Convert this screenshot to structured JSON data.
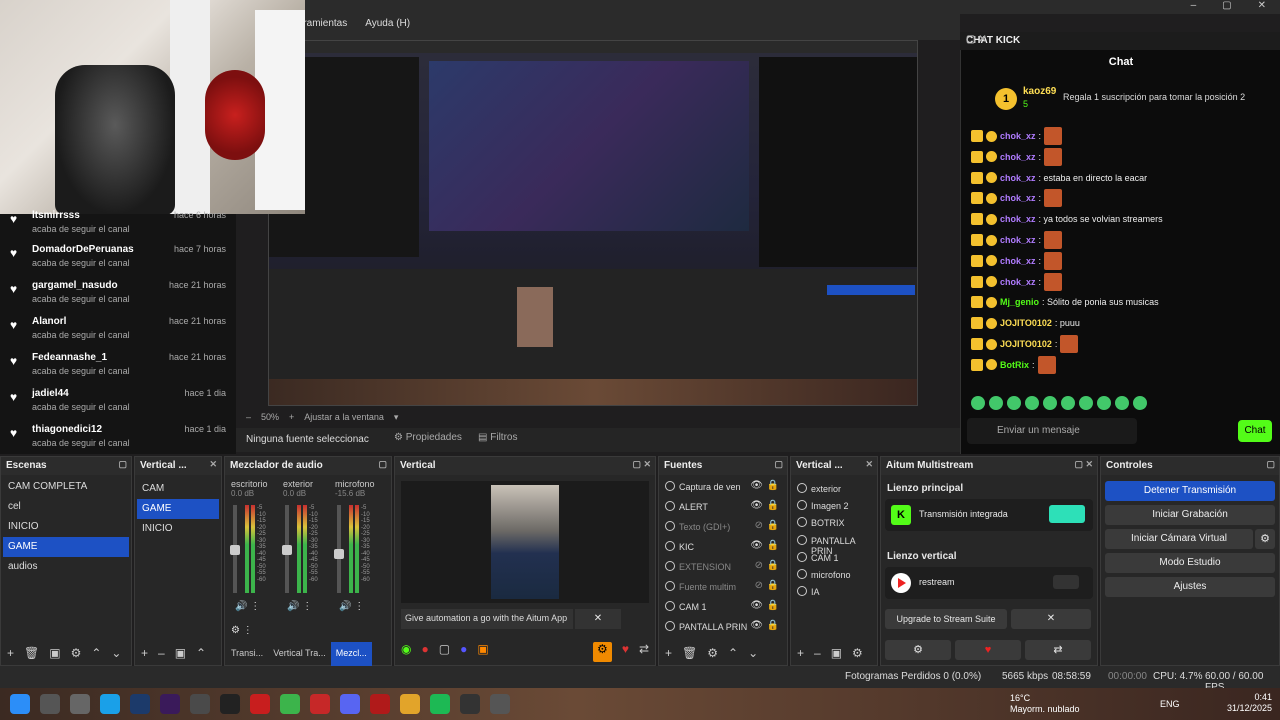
{
  "menu": [
    "rramientas",
    "Ayuda (H)"
  ],
  "window_controls": [
    "–",
    "▢",
    "✕"
  ],
  "feed": [
    {
      "user": "ltsmirrsss",
      "sub": "acaba de seguir el canal",
      "time": "hace 6 horas"
    },
    {
      "user": "DomadorDePeruanas",
      "sub": "acaba de seguir el canal",
      "time": "hace 7 horas"
    },
    {
      "user": "gargamel_nasudo",
      "sub": "acaba de seguir el canal",
      "time": "hace 21 horas"
    },
    {
      "user": "Alanorl",
      "sub": "acaba de seguir el canal",
      "time": "hace 21 horas"
    },
    {
      "user": "Fedeannashe_1",
      "sub": "acaba de seguir el canal",
      "time": "hace 21 horas"
    },
    {
      "user": "jadiel44",
      "sub": "acaba de seguir el canal",
      "time": "hace 1 dia"
    },
    {
      "user": "thiagonedici12",
      "sub": "acaba de seguir el canal",
      "time": "hace 1 dia"
    }
  ],
  "zoom": {
    "value": "50%",
    "fit": "Ajustar a la ventana"
  },
  "source_bar": {
    "label": "Ninguna fuente seleccionac",
    "props": "Propiedades",
    "filters": "Filtros"
  },
  "chat": {
    "dock_title": "CHAT KICK",
    "header": "Chat",
    "pinned": {
      "name": "kaoz69",
      "count": "5",
      "badge": "1",
      "message": "Regala 1 suscripción para tomar la posición 2"
    },
    "lines": [
      {
        "user": "chok_xz",
        "text": ":",
        "color": "#b07cff"
      },
      {
        "user": "chok_xz",
        "text": ":",
        "color": "#b07cff"
      },
      {
        "user": "chok_xz",
        "text": ": estaba en directo la eacar",
        "color": "#b07cff"
      },
      {
        "user": "chok_xz",
        "text": ":",
        "color": "#b07cff"
      },
      {
        "user": "chok_xz",
        "text": ": ya todos se volvian streamers",
        "color": "#b07cff"
      },
      {
        "user": "chok_xz",
        "text": ":",
        "color": "#b07cff"
      },
      {
        "user": "chok_xz",
        "text": ":",
        "color": "#b07cff"
      },
      {
        "user": "chok_xz",
        "text": ":",
        "color": "#b07cff"
      },
      {
        "user": "Mj_genio",
        "text": ": Sólito de ponia sus musicas",
        "color": "#53fc18"
      },
      {
        "user": "JOJITO0102",
        "text": ": puuu",
        "color": "#ffdf55"
      },
      {
        "user": "JOJITO0102",
        "text": ":",
        "color": "#ffdf55"
      },
      {
        "user": "BotRix",
        "text": ":",
        "color": "#53fc18"
      }
    ],
    "input_placeholder": "Enviar un mensaje",
    "send": "Chat"
  },
  "scenes": {
    "title": "Escenas",
    "items": [
      "CAM COMPLETA",
      "cel",
      "INICIO",
      "GAME",
      "audios"
    ],
    "selected": 3
  },
  "vertical_scenes": {
    "title": "Vertical ...",
    "items": [
      "CAM",
      "GAME",
      "INICIO"
    ],
    "selected": 1
  },
  "mixer": {
    "title": "Mezclador de audio",
    "channels": [
      {
        "name": "escritorio",
        "db": "0.0 dB",
        "level": 0.55
      },
      {
        "name": "exterior",
        "db": "0.0 dB",
        "level": 0.55
      },
      {
        "name": "microfono",
        "db": "-15.6 dB",
        "level": 0.5
      }
    ],
    "scale": [
      "-5",
      "-10",
      "-15",
      "-20",
      "-25",
      "-30",
      "-35",
      "-40",
      "-45",
      "-50",
      "-55",
      "-60"
    ]
  },
  "tabs": [
    "Transi...",
    "Vertical Tra...",
    "Mezcl..."
  ],
  "vertical_preview": {
    "title": "Vertical",
    "banner": "Give automation a go with the Aitum App"
  },
  "sources": {
    "title": "Fuentes",
    "items": [
      {
        "name": "Captura de ven",
        "visible": true
      },
      {
        "name": "ALERT",
        "visible": true
      },
      {
        "name": "Texto (GDI+)",
        "visible": false
      },
      {
        "name": "KIC",
        "visible": true
      },
      {
        "name": "EXTENSION",
        "visible": false
      },
      {
        "name": "Fuente multim",
        "visible": false
      },
      {
        "name": "CAM 1",
        "visible": true
      },
      {
        "name": "PANTALLA PRIN",
        "visible": true
      }
    ]
  },
  "vertical_sources": {
    "title": "Vertical ...",
    "items": [
      "exterior",
      "Imagen 2",
      "BOTRIX",
      "PANTALLA PRIN",
      "CAM 1",
      "microfono",
      "IA"
    ]
  },
  "aitum": {
    "title": "Aitum Multistream",
    "main_label": "Lienzo principal",
    "main_service": "Transmisión integrada",
    "vertical_label": "Lienzo vertical",
    "vertical_service": "restream",
    "upgrade": "Upgrade to Stream Suite"
  },
  "controls": {
    "title": "Controles",
    "buttons": [
      "Detener Transmisión",
      "Iniciar Grabación",
      "Iniciar Cámara Virtual",
      "Modo Estudio",
      "Ajustes"
    ]
  },
  "status": {
    "dropped": "Fotogramas Perdidos 0 (0.0%)",
    "bitrate": "5665 kbps",
    "stream_time": "08:58:59",
    "rec_time": "00:00:00",
    "cpu": "CPU: 4.7%",
    "fps": "60.00 / 60.00 FPS"
  },
  "taskbar": {
    "temp": "16°C",
    "weather": "Mayorm. nublado",
    "lang": "ENG",
    "time": "0:41",
    "date": "31/12/2025"
  },
  "colors": {
    "accent": "#1d51c4",
    "kick_green": "#53fc18",
    "panel": "#272727"
  }
}
